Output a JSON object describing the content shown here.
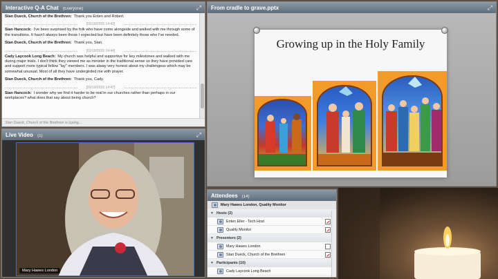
{
  "chat": {
    "title": "Interactive Q-A Chat",
    "audience": "(Everyone)",
    "items": [
      {
        "who": "Stan Dueck, Church of the Brethren:",
        "text": "Thank you Enten and Robert."
      },
      {
        "stamp": "[03/19/2015 14:42]"
      },
      {
        "who": "Sian Hancock:",
        "text": "I've been surprised by the folk who have come alongside and walked with me through some of the transitions. It hasn't always been those I expected but have been definitely those who I've needed."
      },
      {
        "who": "Stan Dueck, Church of the Brethren:",
        "text": "Thank you, Sian."
      },
      {
        "stamp": "[03/19/2015 14:44]"
      },
      {
        "who": "Cady Laycook  Long Beach:",
        "text": "My church was helpful and supportive for key milestones and walked with me during major trials. I don't think they viewed me as minister in the traditional sense so they have provided care and support more typical fellow \"lay\" members. I was alway very honest about my challengess which may be somewhat unusual. Most of all they have undergirded me with prayer."
      },
      {
        "who": "Stan Dueck, Church of the Brethren:",
        "text": "Thank you, Cady."
      },
      {
        "stamp": "[03/19/2015 14:47]"
      },
      {
        "who": "Sian Hancock:",
        "text": "I wonder why we find it harder to be real in our churches rather than perhaps in our workplaces? what does that say about being church?"
      }
    ],
    "typing_status": "Stan Dueck, Church of the Brethren is typing..."
  },
  "slides": {
    "title": "From cradle to grave.pptx",
    "slide_title": "Growing up in the Holy Family"
  },
  "video": {
    "title": "Live Video",
    "count": "(1)",
    "name_tag": "Mary Hawes London"
  },
  "attendees": {
    "title": "Attendees",
    "count": "(14)",
    "selected": "Mary Hawes London, Quality Monitor",
    "groups": [
      {
        "label": "Hosts (2)",
        "members": [
          "Enten Eller - Tech Host",
          "Quality Monitor"
        ]
      },
      {
        "label": "Presenters (2)",
        "members": [
          "Mary Hawes London",
          "Stan Dueck, Church of the Brethren"
        ]
      },
      {
        "label": "Participants (10)",
        "members": [
          "Cady Laycook  Long Beach"
        ]
      }
    ]
  },
  "colors": {
    "pod_header": "#6b7886",
    "slide_accent": "#f29a2a"
  }
}
